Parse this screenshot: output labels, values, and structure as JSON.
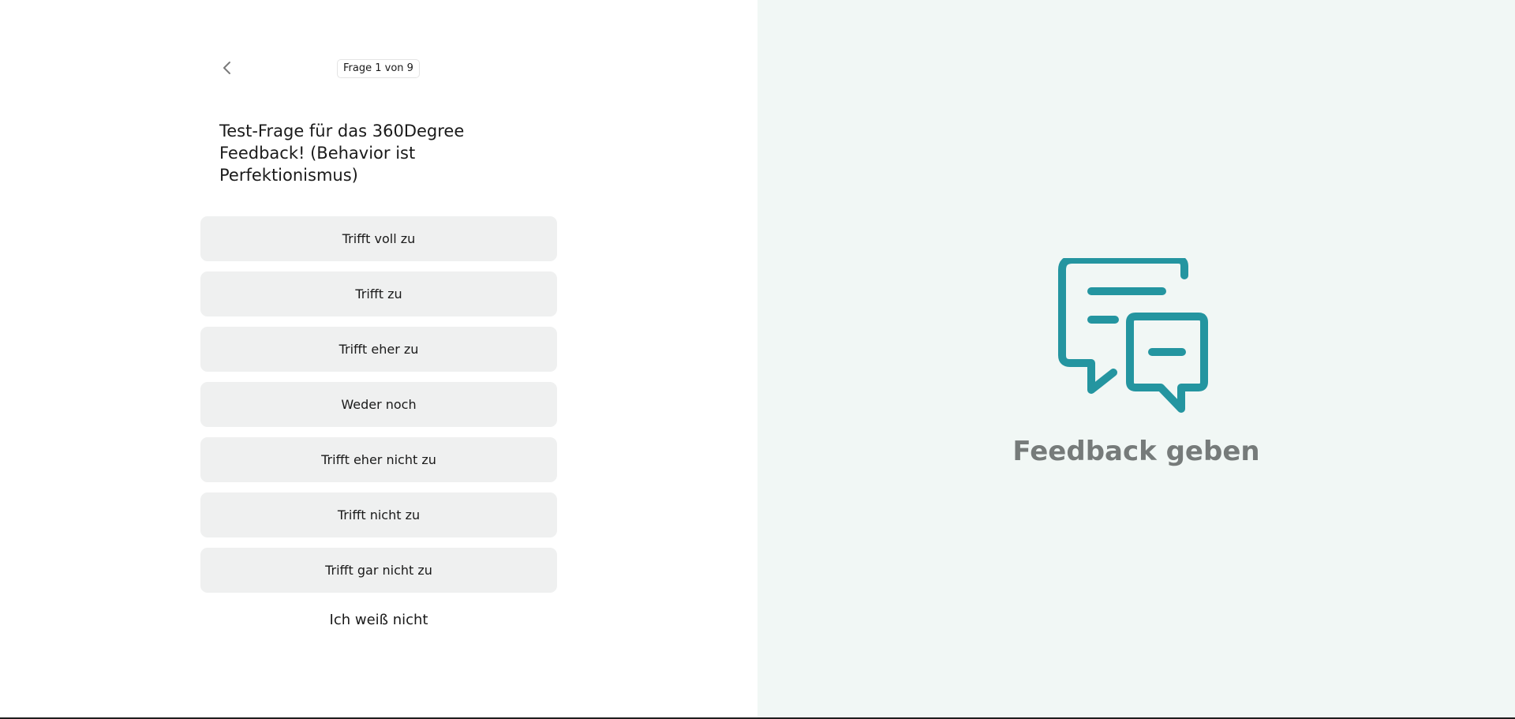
{
  "survey": {
    "counter": "Frage 1 von 9",
    "question": "Test-Frage für das 360Degree Feedback! (Behavior ist Perfektionismus)",
    "options": [
      {
        "label": "Trifft voll zu"
      },
      {
        "label": "Trifft zu"
      },
      {
        "label": "Trifft eher zu"
      },
      {
        "label": "Weder noch"
      },
      {
        "label": "Trifft eher nicht zu"
      },
      {
        "label": "Trifft nicht zu"
      },
      {
        "label": "Trifft gar nicht zu"
      }
    ],
    "dont_know": "Ich weiß nicht",
    "back_icon": "chevron-left-icon"
  },
  "side_panel": {
    "title": "Feedback geben",
    "icon": "chat-bubbles-icon",
    "accent_color": "#2495a0",
    "background_color": "#f1f7f5"
  }
}
